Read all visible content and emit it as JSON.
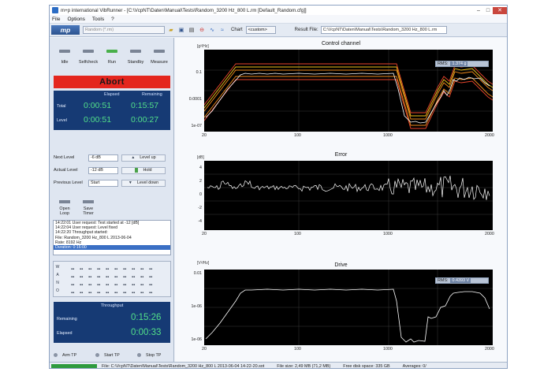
{
  "window": {
    "title": "m+p international VibRunner - [C:\\VcpNT\\Daten\\Manual\\Tests\\Random_3200 Hz_800 L.rm   [Default_Random.cfg]]",
    "minimize": "–",
    "maximize": "□",
    "close": "✕"
  },
  "menu": [
    "File",
    "Options",
    "Tools",
    "?"
  ],
  "toolbar": {
    "logo": "mp",
    "test_combo": "Random (*.rm)",
    "chart_label": "Chart",
    "chart_combo": "<custom>",
    "result_label": "Result File:",
    "result_value": "C:\\VcpNT\\Daten\\Manual\\Tests\\Random_3200 Hz_800 L.rm"
  },
  "states": [
    "Idle",
    "Selfcheck",
    "Run",
    "Standby",
    "Measure"
  ],
  "abort_label": "Abort",
  "timers": {
    "elapsed_header": "Elapsed",
    "remaining_header": "Remaining",
    "total_label": "Total",
    "level_label": "Level",
    "total_elapsed": "0:00:51",
    "total_remaining": "0:15:57",
    "level_elapsed": "0:00:51",
    "level_remaining": "0:00:27"
  },
  "levels": {
    "next_label": "Next Level",
    "next_value": "-6 dB",
    "actual_label": "Actual Level",
    "actual_value": "-12 dB",
    "previous_label": "Previous Level",
    "previous_value": "Start",
    "up_label": "Level up",
    "hold_label": "Hold",
    "down_label": "Level down"
  },
  "loop_buttons": {
    "open_loop": "Open Loop",
    "save_timer": "Save Timer"
  },
  "log": [
    "14:22:01  User request: Test started at      -12 [dB]",
    "14:22:04  User request: Level fixed",
    "14:22:20  Throughput started:",
    "             File: Random_3200 Hz_800 L 2013-06-04",
    "             Rate: 8192 Hz",
    "             Duration: 0:16:00"
  ],
  "wano_letters": [
    "W",
    "A",
    "N",
    "O"
  ],
  "throughput": {
    "header": "Throughput",
    "remaining_label": "Remaining",
    "remaining_value": "0:15:26",
    "elapsed_label": "Elapsed",
    "elapsed_value": "0:00:33",
    "arm_label": "Arm TP",
    "start_label": "Start TP",
    "stop_label": "Stop TP"
  },
  "charts": {
    "control": {
      "title": "Control channel",
      "unit": "[g²/Hz]",
      "rms_label": "RMS:",
      "rms_value": "1.374 g",
      "yticks": [
        "1",
        "0.1",
        "0.0001",
        "1e-07"
      ],
      "xticks": [
        "20",
        "100",
        "1000",
        "2000"
      ]
    },
    "error": {
      "title": "Error",
      "unit": "[dB]",
      "yticks": [
        "4",
        "2",
        "0",
        "-2",
        "-4"
      ],
      "xticks": [
        "20",
        "100",
        "1000",
        "2000"
      ]
    },
    "drive": {
      "title": "Drive",
      "unit": "[V²/Hz]",
      "rms_label": "RMS:",
      "rms_value": "0.4393 V",
      "yticks": [
        "0.01",
        "1e-06",
        "1e-06"
      ],
      "xticks": [
        "20",
        "100",
        "1000",
        "2000"
      ]
    }
  },
  "status": {
    "file": "File: C:\\VcpNT\\Daten\\Manual\\Tests\\Random_3200 Hz_800 L 2013-06-04 14-22-20.sot",
    "file_size": "File size: 2,49 MB (71,2 MB)",
    "disk": "Free disk space: 335 GB",
    "averages": "Averages: 0/"
  },
  "colors": {
    "window_bg": "#eef2f8",
    "abort_red": "#e4261e",
    "panel_blue": "#163a74",
    "clock_green": "#52e089",
    "plot_bg": "#000000",
    "trace_white": "#ffffff",
    "alarm_red": "#e8452c",
    "abort_yellow": "#f2c21a",
    "warn_orange": "#f08a1c",
    "status_green": "#2e9b3e"
  }
}
